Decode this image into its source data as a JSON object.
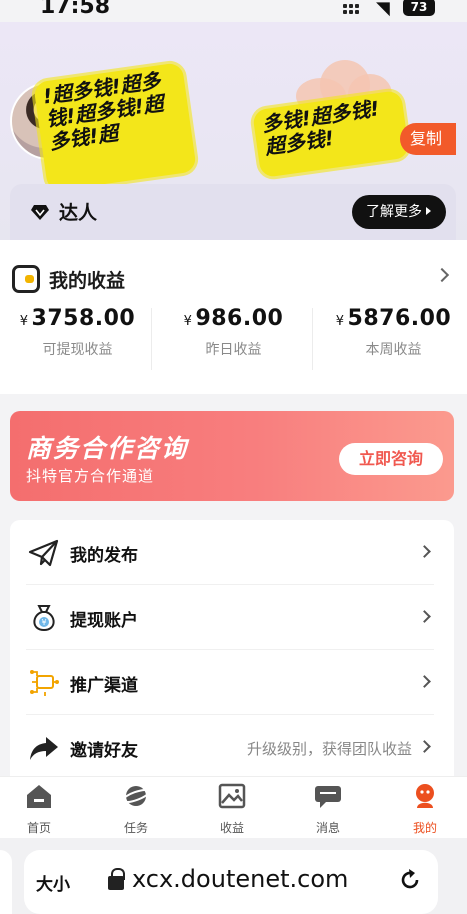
{
  "status_bar": {
    "time": "17:58",
    "battery": "73"
  },
  "header": {
    "sticker_text_1": "!超多钱!超多钱!超多钱!超多钱!超",
    "sticker_text_2": "多钱!超多钱!超多钱!",
    "copy_label": "复制",
    "badge": {
      "label": "达人",
      "more_label": "了解更多"
    }
  },
  "earnings": {
    "title": "我的收益",
    "currency": "¥",
    "stats": [
      {
        "amount": "3758.00",
        "label": "可提现收益"
      },
      {
        "amount": "986.00",
        "label": "昨日收益"
      },
      {
        "amount": "5876.00",
        "label": "本周收益"
      }
    ]
  },
  "promo": {
    "title": "商务合作咨询",
    "subtitle": "抖特官方合作通道",
    "button": "立即咨询"
  },
  "menu": [
    {
      "label": "我的发布",
      "icon": "paper-plane-icon",
      "extra": ""
    },
    {
      "label": "提现账户",
      "icon": "money-bag-icon",
      "extra": ""
    },
    {
      "label": "推广渠道",
      "icon": "channel-network-icon",
      "extra": ""
    },
    {
      "label": "邀请好友",
      "icon": "share-arrow-icon",
      "extra": "升级级别，获得团队收益"
    }
  ],
  "tabs": [
    {
      "label": "首页",
      "icon": "home-icon"
    },
    {
      "label": "任务",
      "icon": "planet-icon"
    },
    {
      "label": "收益",
      "icon": "image-chart-icon"
    },
    {
      "label": "消息",
      "icon": "message-icon"
    },
    {
      "label": "我的",
      "icon": "profile-icon",
      "active": true
    }
  ],
  "browser": {
    "text_size_label": "大小",
    "url": "xcx.doutenet.com"
  },
  "colors": {
    "accent": "#ec4f1f",
    "promo": "#f46e6e",
    "sticker": "#f3e61a"
  }
}
